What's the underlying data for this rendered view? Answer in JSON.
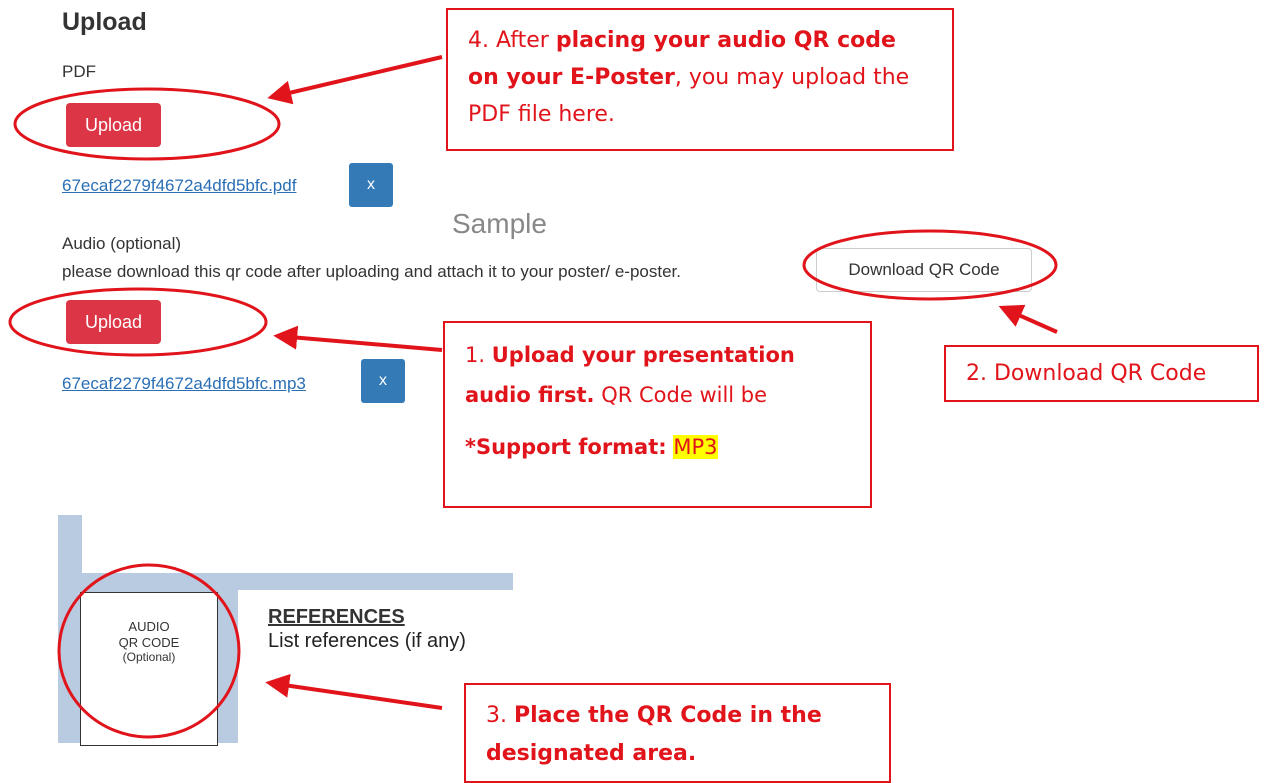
{
  "upload_section": {
    "title": "Upload",
    "pdf": {
      "label": "PDF",
      "upload_label": "Upload",
      "file_name": "67ecaf2279f4672a4dfd5bfc.pdf",
      "remove_label": "x"
    },
    "audio": {
      "label": "Audio (optional)",
      "instruction": "please download this qr code after uploading and attach it to your poster/ e-poster.",
      "download_qr_label": "Download QR Code",
      "upload_label": "Upload",
      "file_name": "67ecaf2279f4672a4dfd5bfc.mp3",
      "remove_label": "x"
    }
  },
  "sample_label": "Sample",
  "poster": {
    "qr_box": {
      "line1": "AUDIO",
      "line2": "QR CODE",
      "line3": "(Optional)"
    },
    "references_heading": "REFERENCES",
    "references_text": "List references (if any)"
  },
  "callouts": {
    "step1": {
      "num": "1.",
      "bold1": "Upload your presentation audio first.",
      "rest": "QR Code will be",
      "format_label": "*Support format:",
      "format_value": "MP3"
    },
    "step2": {
      "text": "2. Download QR Code"
    },
    "step3": {
      "num": "3.",
      "bold1": "Place the QR Code in the designated area."
    },
    "step4": {
      "num": "4. After",
      "bold1": "placing your audio QR code on your E-Poster",
      "rest": ", you may upload the PDF file here."
    }
  },
  "colors": {
    "annotation_red": "#e0141a",
    "upload_red": "#dc3545",
    "remove_blue": "#337ab7",
    "highlight": "#ffff00"
  }
}
